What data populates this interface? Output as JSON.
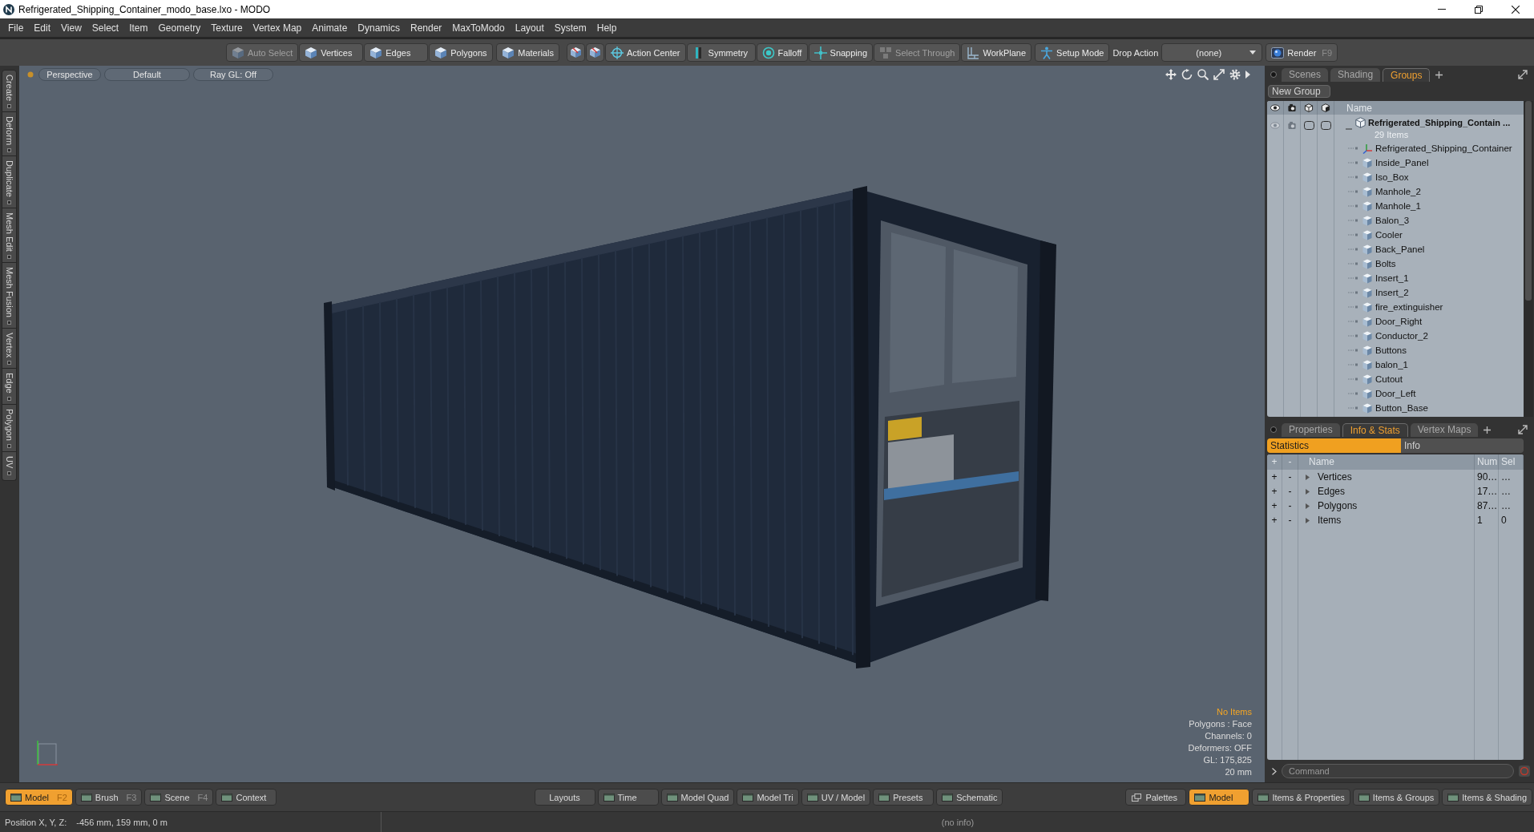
{
  "window": {
    "title": "Refrigerated_Shipping_Container_modo_base.lxo - MODO"
  },
  "menu": [
    "File",
    "Edit",
    "View",
    "Select",
    "Item",
    "Geometry",
    "Texture",
    "Vertex Map",
    "Animate",
    "Dynamics",
    "Render",
    "MaxToModo",
    "Layout",
    "System",
    "Help"
  ],
  "toolbar": [
    {
      "kind": "button",
      "label": "Auto Select",
      "disabled": true
    },
    {
      "kind": "button",
      "label": "Vertices",
      "disabled": false
    },
    {
      "kind": "button",
      "label": "Edges",
      "disabled": false
    },
    {
      "kind": "button",
      "label": "Polygons",
      "disabled": false
    },
    {
      "kind": "button",
      "label": "Materials",
      "disabled": false
    },
    {
      "kind": "icon",
      "disabled": false
    },
    {
      "kind": "icon",
      "disabled": false
    },
    {
      "kind": "button",
      "label": "Action Center",
      "disabled": false
    },
    {
      "kind": "button",
      "label": "Symmetry",
      "disabled": false
    },
    {
      "kind": "button",
      "label": "Falloff",
      "disabled": false
    },
    {
      "kind": "button",
      "label": "Snapping",
      "disabled": false
    },
    {
      "kind": "button",
      "label": "Select Through",
      "disabled": true
    },
    {
      "kind": "button",
      "label": "WorkPlane",
      "disabled": false
    },
    {
      "kind": "button",
      "label": "Setup Mode",
      "disabled": false
    },
    {
      "kind": "label",
      "label": "Drop Action",
      "disabled": false
    },
    {
      "kind": "dropdown",
      "value": "(none)",
      "disabled": false
    },
    {
      "kind": "button",
      "label": "Render",
      "shortcut": "F9",
      "disabled": false
    }
  ],
  "side_tabs": [
    "Create",
    "Deform",
    "Duplicate",
    "Mesh Edit",
    "Mesh Fusion",
    "Vertex",
    "Edge",
    "Polygon",
    "UV"
  ],
  "viewport": {
    "options": [
      "Perspective",
      "Default",
      "Ray GL: Off"
    ],
    "info": [
      {
        "kind": "alert",
        "text": "No Items"
      },
      {
        "kind": "plain",
        "text": "Polygons : Face"
      },
      {
        "kind": "plain",
        "text": "Channels: 0"
      },
      {
        "kind": "plain",
        "text": "Deformers: OFF"
      },
      {
        "kind": "plain",
        "text": "GL: 175,825"
      },
      {
        "kind": "plain",
        "text": "20 mm"
      }
    ]
  },
  "groups_panel": {
    "tabs": [
      {
        "label": "Scenes",
        "selected": false
      },
      {
        "label": "Shading",
        "selected": false
      },
      {
        "label": "Groups",
        "selected": true
      }
    ],
    "new_group": "New Group",
    "name_column": "Name",
    "tree": {
      "label": "Refrigerated_Shipping_Contain ...",
      "count": "29 Items",
      "expanded": true,
      "children": [
        {
          "kind": "locator",
          "label": "Refrigerated_Shipping_Container"
        },
        {
          "kind": "mesh",
          "label": "Inside_Panel"
        },
        {
          "kind": "mesh",
          "label": "Iso_Box"
        },
        {
          "kind": "mesh",
          "label": "Manhole_2"
        },
        {
          "kind": "mesh",
          "label": "Manhole_1"
        },
        {
          "kind": "mesh",
          "label": "Balon_3"
        },
        {
          "kind": "mesh",
          "label": "Cooler"
        },
        {
          "kind": "mesh",
          "label": "Back_Panel"
        },
        {
          "kind": "mesh",
          "label": "Bolts"
        },
        {
          "kind": "mesh",
          "label": "Insert_1"
        },
        {
          "kind": "mesh",
          "label": "Insert_2"
        },
        {
          "kind": "mesh",
          "label": "fire_extinguisher"
        },
        {
          "kind": "mesh",
          "label": "Door_Right"
        },
        {
          "kind": "mesh",
          "label": "Conductor_2"
        },
        {
          "kind": "mesh",
          "label": "Buttons"
        },
        {
          "kind": "mesh",
          "label": "balon_1"
        },
        {
          "kind": "mesh",
          "label": "Cutout"
        },
        {
          "kind": "mesh",
          "label": "Door_Left"
        },
        {
          "kind": "mesh",
          "label": "Button_Base"
        }
      ]
    }
  },
  "stats_panel": {
    "tabs": [
      {
        "label": "Properties",
        "selected": false
      },
      {
        "label": "Info & Stats",
        "selected": true
      },
      {
        "label": "Vertex Maps",
        "selected": false
      }
    ],
    "subtabs": [
      {
        "label": "Statistics",
        "selected": true
      },
      {
        "label": "Info",
        "selected": false
      }
    ],
    "columns": [
      "+",
      "-",
      "Name",
      "Num",
      "Sel"
    ],
    "rows": [
      {
        "add": "+",
        "remove": "-",
        "name": "Vertices",
        "num": "90…",
        "sel": "…",
        "expanded": false
      },
      {
        "add": "+",
        "remove": "-",
        "name": "Edges",
        "num": "17…",
        "sel": "…",
        "expanded": false
      },
      {
        "add": "+",
        "remove": "-",
        "name": "Polygons",
        "num": "87…",
        "sel": "…",
        "expanded": false
      },
      {
        "add": "+",
        "remove": "-",
        "name": "Items",
        "num": "1",
        "sel": "0",
        "expanded": false
      }
    ]
  },
  "command": {
    "placeholder": "Command"
  },
  "layout_bar": {
    "left": [
      {
        "kind": "layout",
        "label": "Model",
        "shortcut": "F2",
        "selected": true
      },
      {
        "kind": "layout",
        "label": "Brush",
        "shortcut": "F3",
        "selected": false
      },
      {
        "kind": "layout",
        "label": "Scene",
        "shortcut": "F4",
        "selected": false
      },
      {
        "kind": "layout",
        "label": "Context",
        "selected": false
      }
    ],
    "center": [
      {
        "kind": "menu",
        "label": "Layouts",
        "selected": false
      },
      {
        "kind": "layout",
        "label": "Time",
        "selected": false
      },
      {
        "kind": "layout",
        "label": "Model Quad",
        "selected": false
      },
      {
        "kind": "layout",
        "label": "Model Tri",
        "selected": false
      },
      {
        "kind": "layout",
        "label": "UV / Model",
        "selected": false
      },
      {
        "kind": "layout",
        "label": "Presets",
        "selected": false
      },
      {
        "kind": "layout",
        "label": "Schematic",
        "selected": false
      }
    ],
    "right": [
      {
        "kind": "palette",
        "label": "Palettes",
        "selected": false
      },
      {
        "kind": "layout",
        "label": "Model",
        "selected": true
      },
      {
        "kind": "layout",
        "label": "Items & Properties",
        "selected": false
      },
      {
        "kind": "layout",
        "label": "Items & Groups",
        "selected": false
      },
      {
        "kind": "layout",
        "label": "Items & Shading",
        "selected": false
      }
    ]
  },
  "status_bar": {
    "position_label": "Position X, Y, Z:",
    "position_value": "-456 mm, 159 mm, 0 m",
    "info": "(no info)"
  }
}
